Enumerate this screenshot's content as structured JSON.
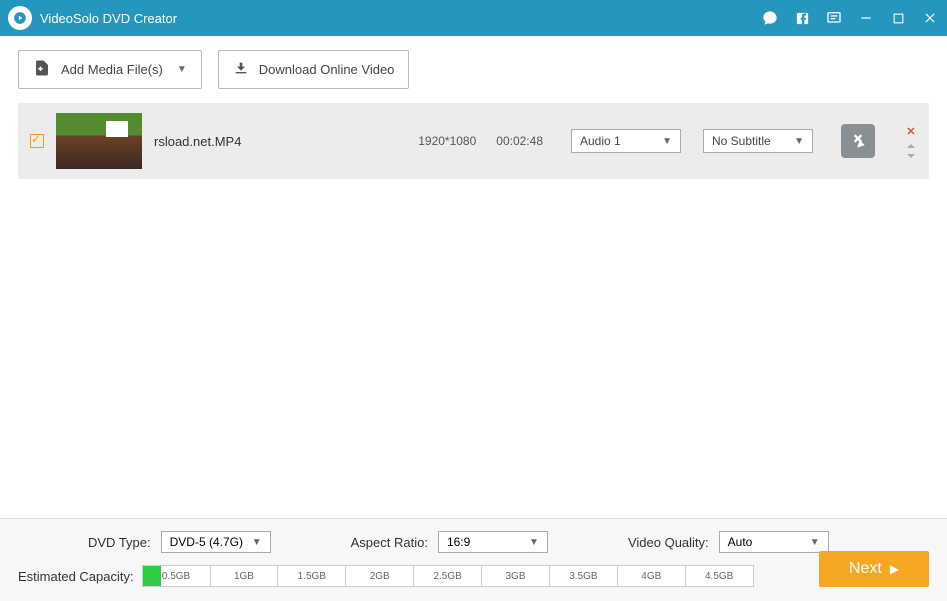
{
  "app": {
    "title": "VideoSolo DVD Creator"
  },
  "toolbar": {
    "add_media": "Add Media File(s)",
    "download": "Download Online Video"
  },
  "media": [
    {
      "filename": "rsload.net.MP4",
      "resolution": "1920*1080",
      "duration": "00:02:48",
      "audio": "Audio 1",
      "subtitle": "No Subtitle"
    }
  ],
  "bottom": {
    "dvd_type_label": "DVD Type:",
    "dvd_type_value": "DVD-5 (4.7G)",
    "aspect_ratio_label": "Aspect Ratio:",
    "aspect_ratio_value": "16:9",
    "video_quality_label": "Video Quality:",
    "video_quality_value": "Auto",
    "capacity_label": "Estimated Capacity:",
    "ticks": [
      "0.5GB",
      "1GB",
      "1.5GB",
      "2GB",
      "2.5GB",
      "3GB",
      "3.5GB",
      "4GB",
      "4.5GB"
    ],
    "next": "Next"
  }
}
